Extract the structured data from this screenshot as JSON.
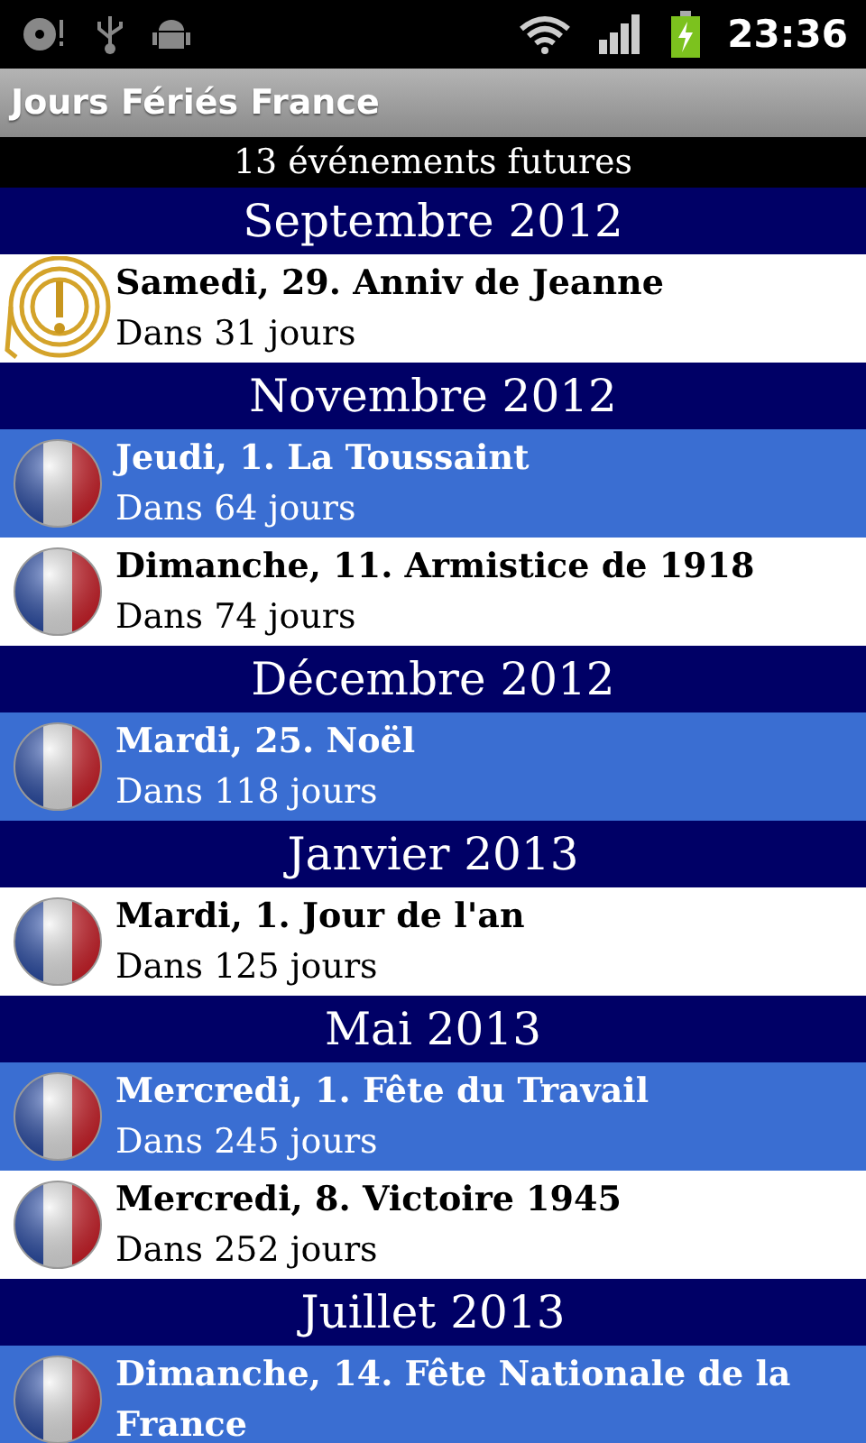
{
  "status_bar": {
    "time": "23:36"
  },
  "app_title": "Jours Fériés France",
  "summary": "13 événements futures",
  "sections": [
    {
      "header": "Septembre 2012",
      "events": [
        {
          "kind": "symbol",
          "shaded": false,
          "title": "Samedi, 29. Anniv de Jeanne",
          "subtitle": "Dans 31 jours"
        }
      ]
    },
    {
      "header": "Novembre 2012",
      "events": [
        {
          "kind": "flag",
          "shaded": true,
          "title": "Jeudi, 1. La Toussaint",
          "subtitle": "Dans 64 jours"
        },
        {
          "kind": "flag",
          "shaded": false,
          "title": "Dimanche, 11. Armistice de 1918",
          "subtitle": "Dans 74 jours"
        }
      ]
    },
    {
      "header": "Décembre 2012",
      "events": [
        {
          "kind": "flag",
          "shaded": true,
          "title": "Mardi, 25. Noël",
          "subtitle": "Dans 118 jours"
        }
      ]
    },
    {
      "header": "Janvier 2013",
      "events": [
        {
          "kind": "flag",
          "shaded": false,
          "title": "Mardi, 1. Jour de l'an",
          "subtitle": "Dans 125 jours"
        }
      ]
    },
    {
      "header": "Mai 2013",
      "events": [
        {
          "kind": "flag",
          "shaded": true,
          "title": "Mercredi, 1. Fête du Travail",
          "subtitle": "Dans 245 jours"
        },
        {
          "kind": "flag",
          "shaded": false,
          "title": "Mercredi, 8. Victoire 1945",
          "subtitle": "Dans 252 jours"
        }
      ]
    },
    {
      "header": "Juillet 2013",
      "events": [
        {
          "kind": "flag",
          "shaded": true,
          "title": "Dimanche, 14. Fête Nationale de la France"
        }
      ]
    }
  ]
}
